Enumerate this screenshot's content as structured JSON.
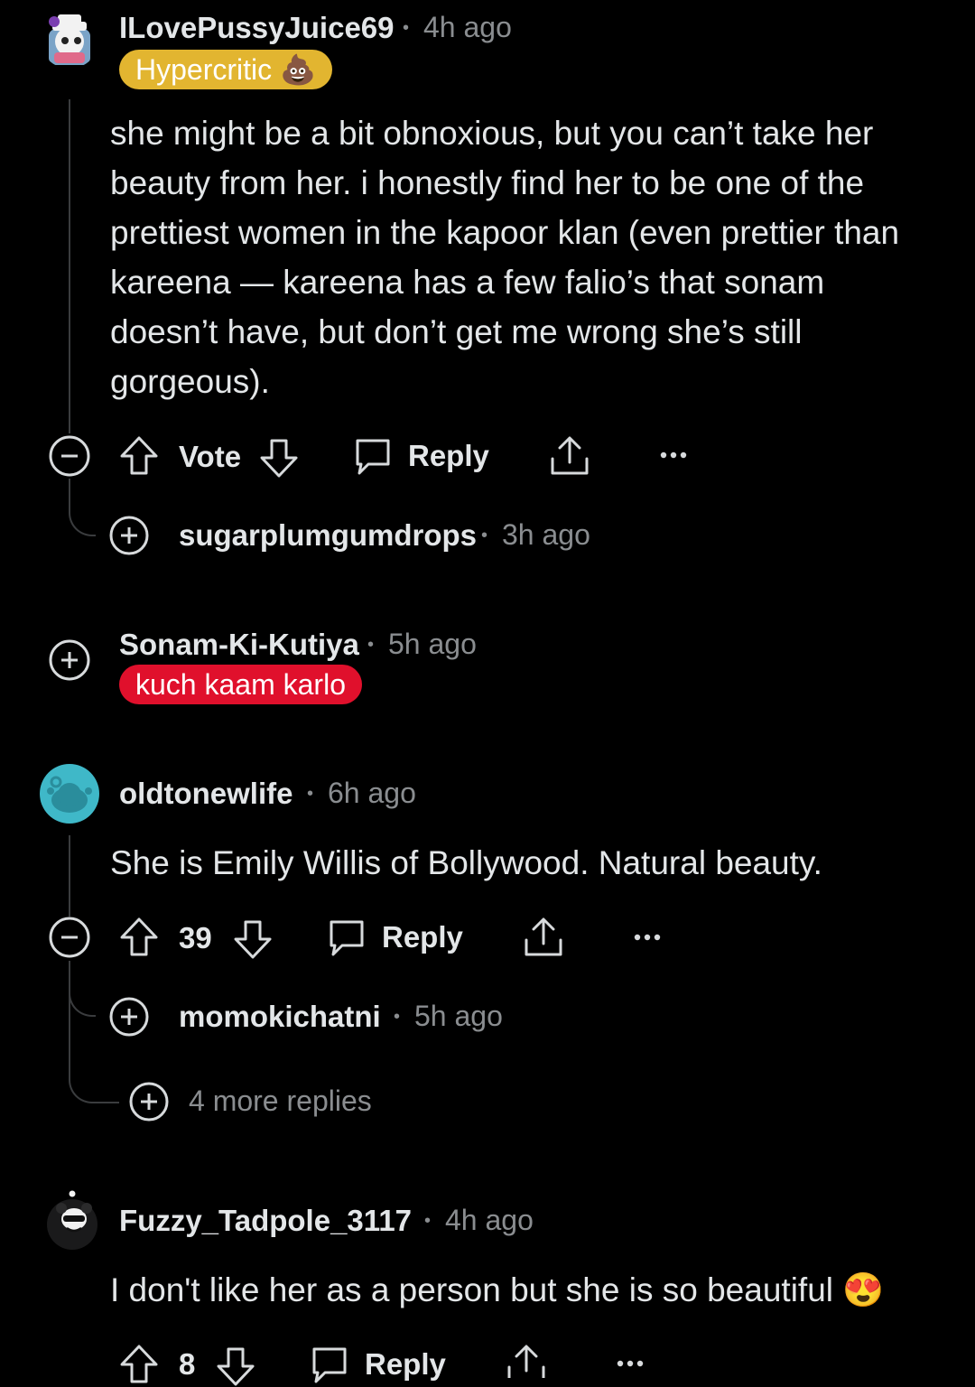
{
  "comments": [
    {
      "username": "ILovePussyJuice69",
      "time": "4h ago",
      "flair": "Hypercritic",
      "flair_emoji": "💩",
      "flair_color": "#e2b530",
      "body": "she might be a bit obnoxious, but you can’t take her beauty from her. i honestly find her to be one of the prettiest women in the kapoor klan (even prettier than kareena — kareena has a few falio’s that sonam doesn’t have, but don’t get me wrong she’s still gorgeous).",
      "vote_label": "Vote",
      "reply_label": "Reply",
      "replies": [
        {
          "username": "sugarplumgumdrops",
          "time": "3h ago"
        }
      ]
    },
    {
      "username": "Sonam-Ki-Kutiya",
      "time": "5h ago",
      "flair": "kuch kaam karlo",
      "flair_color": "#e0102c"
    },
    {
      "username": "oldtonewlife",
      "time": "6h ago",
      "avatar_color": "#3fb8c8",
      "body": "She is Emily Willis of Bollywood. Natural beauty.",
      "vote_label": "39",
      "reply_label": "Reply",
      "replies": [
        {
          "username": "momokichatni",
          "time": "5h ago"
        }
      ],
      "more_replies": "4 more replies"
    },
    {
      "username": "Fuzzy_Tadpole_3117",
      "time": "4h ago",
      "body": "I don't like her as a person but she is so beautiful",
      "body_emoji": "😍",
      "vote_label": "8",
      "reply_label": "Reply"
    }
  ],
  "separator": "•",
  "icons": {
    "collapse": "minus-circle-icon",
    "expand": "plus-circle-icon",
    "upvote": "upvote-arrow-icon",
    "downvote": "downvote-arrow-icon",
    "reply": "speech-bubble-icon",
    "share": "share-icon",
    "more": "ellipsis-icon"
  }
}
